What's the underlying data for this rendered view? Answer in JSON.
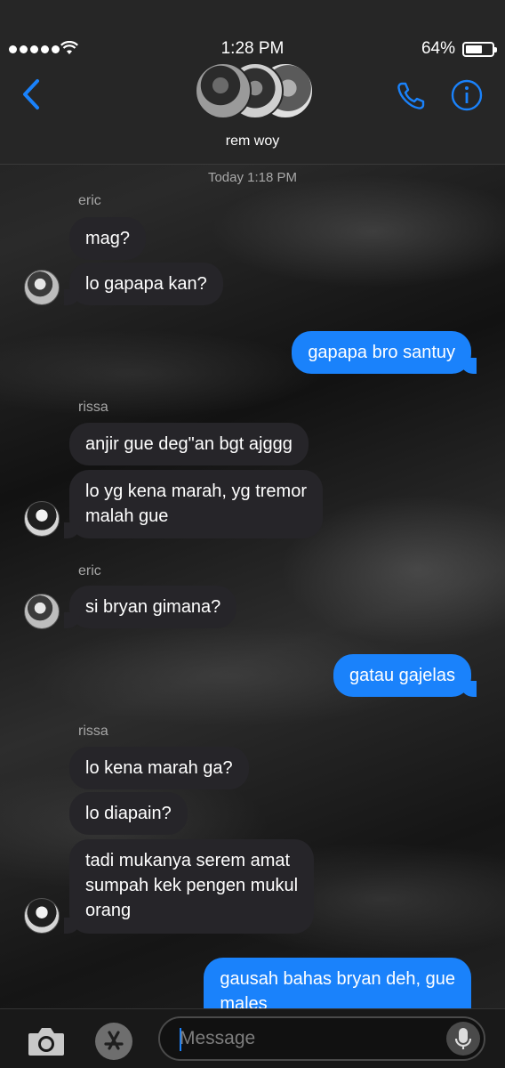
{
  "status_bar": {
    "time": "1:28 PM",
    "battery": "64%",
    "battery_level": 0.64
  },
  "header": {
    "group_name": "rem woy"
  },
  "timestamp": "Today 1:18 PM",
  "messages": [
    {
      "sender": "eric",
      "text": "mag?"
    },
    {
      "text": "lo gapapa kan?"
    },
    {
      "text": "gapapa bro santuy"
    },
    {
      "sender": "rissa",
      "text": "anjir gue deg\"an bgt ajggg"
    },
    {
      "text": "lo yg kena marah, yg tremor"
    },
    {
      "text": "malah gue"
    },
    {
      "sender": "eric",
      "text": "si bryan gimana?"
    },
    {
      "text": "gatau gajelas"
    },
    {
      "sender": "rissa",
      "text": "lo kena marah ga?"
    },
    {
      "text": "lo diapain?"
    },
    {
      "text": "tadi mukanya serem amat"
    },
    {
      "text": "sumpah kek pengen mukul"
    },
    {
      "text": "orang"
    },
    {
      "text": "gausah bahas bryan deh, gue"
    },
    {
      "text": "males"
    }
  ],
  "composer": {
    "placeholder": "Message"
  },
  "icons": {
    "back": "chevron-left-icon",
    "phone": "phone-icon",
    "info": "info-icon",
    "camera": "camera-icon",
    "appstore": "appstore-icon",
    "mic": "microphone-icon"
  },
  "colors": {
    "accent": "#1a82fb",
    "incoming_bubble": "#262529",
    "header_bg": "#262626"
  }
}
